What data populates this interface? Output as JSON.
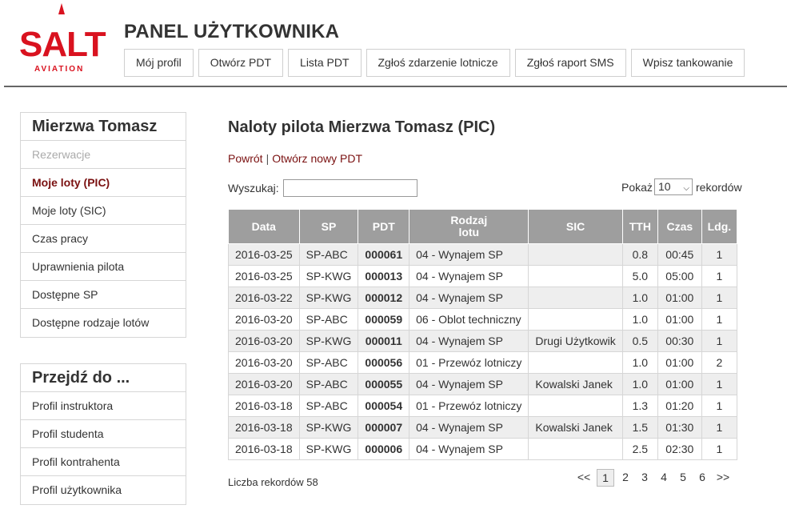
{
  "header": {
    "logo_text": "SALT",
    "logo_subtext": "AVIATION",
    "title": "PANEL UŻYTKOWNIKA",
    "nav": [
      {
        "label": "Mój profil"
      },
      {
        "label": "Otwórz PDT"
      },
      {
        "label": "Lista PDT"
      },
      {
        "label": "Zgłoś zdarzenie lotnicze"
      },
      {
        "label": "Zgłoś raport SMS"
      },
      {
        "label": "Wpisz tankowanie"
      }
    ]
  },
  "sidebar": {
    "user_box": {
      "title": "Mierzwa Tomasz",
      "items": [
        {
          "label": "Rezerwacje",
          "state": "disabled"
        },
        {
          "label": "Moje loty (PIC)",
          "state": "active"
        },
        {
          "label": "Moje loty (SIC)",
          "state": "normal"
        },
        {
          "label": "Czas pracy",
          "state": "normal"
        },
        {
          "label": "Uprawnienia pilota",
          "state": "normal"
        },
        {
          "label": "Dostępne SP",
          "state": "normal"
        },
        {
          "label": "Dostępne rodzaje lotów",
          "state": "normal"
        }
      ]
    },
    "goto_box": {
      "title": "Przejdź do ...",
      "items": [
        {
          "label": "Profil instruktora"
        },
        {
          "label": "Profil studenta"
        },
        {
          "label": "Profil kontrahenta"
        },
        {
          "label": "Profil użytkownika"
        }
      ]
    }
  },
  "main": {
    "title": "Naloty pilota Mierzwa Tomasz (PIC)",
    "back_link": "Powrót",
    "separator": "|",
    "new_pdt_link": "Otwórz nowy PDT",
    "search_label": "Wyszukaj:",
    "search_value": "",
    "show_label": "Pokaż",
    "show_value": "10",
    "records_label": "rekordów",
    "table": {
      "headers": [
        "Data",
        "SP",
        "PDT",
        "Rodzaj\nlotu",
        "SIC",
        "TTH",
        "Czas",
        "Ldg."
      ],
      "rows": [
        [
          "2016-03-25",
          "SP-ABC",
          "000061",
          "04 - Wynajem SP",
          "",
          "0.8",
          "00:45",
          "1"
        ],
        [
          "2016-03-25",
          "SP-KWG",
          "000013",
          "04 - Wynajem SP",
          "",
          "5.0",
          "05:00",
          "1"
        ],
        [
          "2016-03-22",
          "SP-KWG",
          "000012",
          "04 - Wynajem SP",
          "",
          "1.0",
          "01:00",
          "1"
        ],
        [
          "2016-03-20",
          "SP-ABC",
          "000059",
          "06 - Oblot techniczny",
          "",
          "1.0",
          "01:00",
          "1"
        ],
        [
          "2016-03-20",
          "SP-KWG",
          "000011",
          "04 - Wynajem SP",
          "Drugi Użytkowik",
          "0.5",
          "00:30",
          "1"
        ],
        [
          "2016-03-20",
          "SP-ABC",
          "000056",
          "01 - Przewóz lotniczy",
          "",
          "1.0",
          "01:00",
          "2"
        ],
        [
          "2016-03-20",
          "SP-ABC",
          "000055",
          "04 - Wynajem SP",
          "Kowalski Janek",
          "1.0",
          "01:00",
          "1"
        ],
        [
          "2016-03-18",
          "SP-ABC",
          "000054",
          "01 - Przewóz lotniczy",
          "",
          "1.3",
          "01:20",
          "1"
        ],
        [
          "2016-03-18",
          "SP-KWG",
          "000007",
          "04 - Wynajem SP",
          "Kowalski Janek",
          "1.5",
          "01:30",
          "1"
        ],
        [
          "2016-03-18",
          "SP-KWG",
          "000006",
          "04 - Wynajem SP",
          "",
          "2.5",
          "02:30",
          "1"
        ]
      ]
    },
    "record_count": "Liczba rekordów 58",
    "pager": {
      "prev": "<<",
      "pages": [
        "1",
        "2",
        "3",
        "4",
        "5",
        "6"
      ],
      "current": "1",
      "next": ">>"
    }
  },
  "colors": {
    "brand_red": "#d9121f",
    "active_link": "#7a1010",
    "table_header_bg": "#9e9e9e",
    "row_stripe": "#eeeeee"
  }
}
